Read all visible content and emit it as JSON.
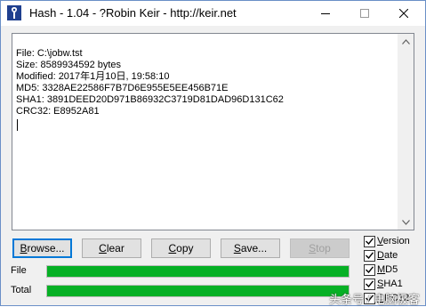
{
  "window": {
    "title": "Hash - 1.04 - ?Robin Keir - http://keir.net"
  },
  "output": {
    "lines": [
      "File: C:\\jobw.tst",
      "Size: 8589934592 bytes",
      "Modified: 2017年1月10日, 19:58:10",
      "MD5: 3328AE22586F7B7D6E955E5EE456B71E",
      "SHA1: 3891DEED20D971B86932C3719D81DAD96D131C62",
      "CRC32: E8952A81"
    ]
  },
  "buttons": {
    "browse": {
      "pre": "",
      "accel": "B",
      "post": "rowse..."
    },
    "clear": {
      "pre": "",
      "accel": "C",
      "post": "lear"
    },
    "copy": {
      "pre": "",
      "accel": "C",
      "post": "opy"
    },
    "save": {
      "pre": "",
      "accel": "S",
      "post": "ave..."
    },
    "stop": {
      "pre": "",
      "accel": "S",
      "post": "top"
    }
  },
  "progress": {
    "file_label": "File",
    "total_label": "Total",
    "file_fraction": 1.0,
    "total_fraction": 1.0,
    "color": "#06b025"
  },
  "options": [
    {
      "label": "Version",
      "accel_index": 0,
      "checked": true
    },
    {
      "label": "Date",
      "accel_index": 0,
      "checked": true
    },
    {
      "label": "MD5",
      "accel_index": 0,
      "checked": true
    },
    {
      "label": "SHA1",
      "accel_index": 0,
      "checked": true
    },
    {
      "label": "CRC32",
      "accel_index": 0,
      "checked": true
    }
  ],
  "watermark": {
    "text": "头条号 / 电脑极客"
  }
}
